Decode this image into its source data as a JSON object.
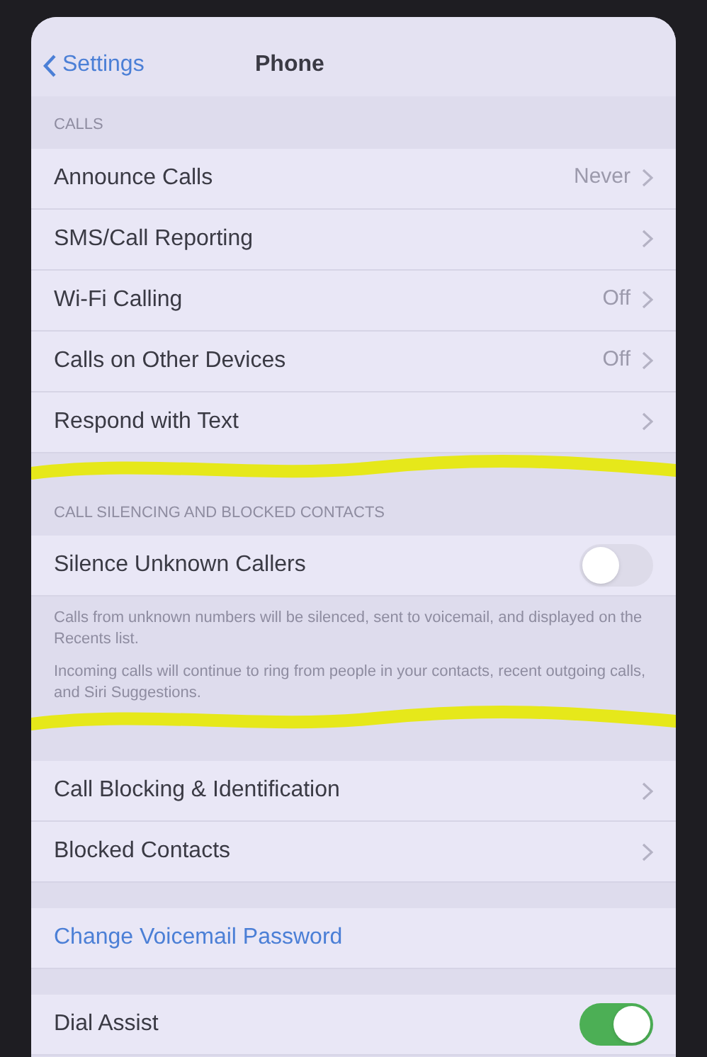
{
  "nav": {
    "back": "Settings",
    "title": "Phone"
  },
  "sections": [
    {
      "header": "CALLS",
      "highlight_after": true,
      "rows": [
        {
          "kind": "link",
          "label": "Announce Calls",
          "value": "Never"
        },
        {
          "kind": "link",
          "label": "SMS/Call Reporting"
        },
        {
          "kind": "link",
          "label": "Wi-Fi Calling",
          "value": "Off"
        },
        {
          "kind": "link",
          "label": "Calls on Other Devices",
          "value": "Off"
        },
        {
          "kind": "link",
          "label": "Respond with Text"
        }
      ]
    },
    {
      "header": "CALL SILENCING AND BLOCKED CONTACTS",
      "highlight_after": true,
      "rows": [
        {
          "kind": "toggle",
          "label": "Silence Unknown Callers",
          "on": false
        }
      ],
      "footer": [
        "Calls from unknown numbers will be silenced, sent to voicemail, and displayed on the Recents list.",
        "Incoming calls will continue to ring from people in your contacts, recent outgoing calls, and Siri Suggestions."
      ]
    },
    {
      "highlight_after": false,
      "rows": [
        {
          "kind": "link",
          "label": "Call Blocking & Identification"
        },
        {
          "kind": "link",
          "label": "Blocked Contacts"
        }
      ]
    },
    {
      "highlight_after": false,
      "rows": [
        {
          "kind": "action",
          "label": "Change Voicemail Password"
        }
      ]
    },
    {
      "highlight_after": false,
      "rows": [
        {
          "kind": "toggle",
          "label": "Dial Assist",
          "on": true
        }
      ]
    }
  ]
}
